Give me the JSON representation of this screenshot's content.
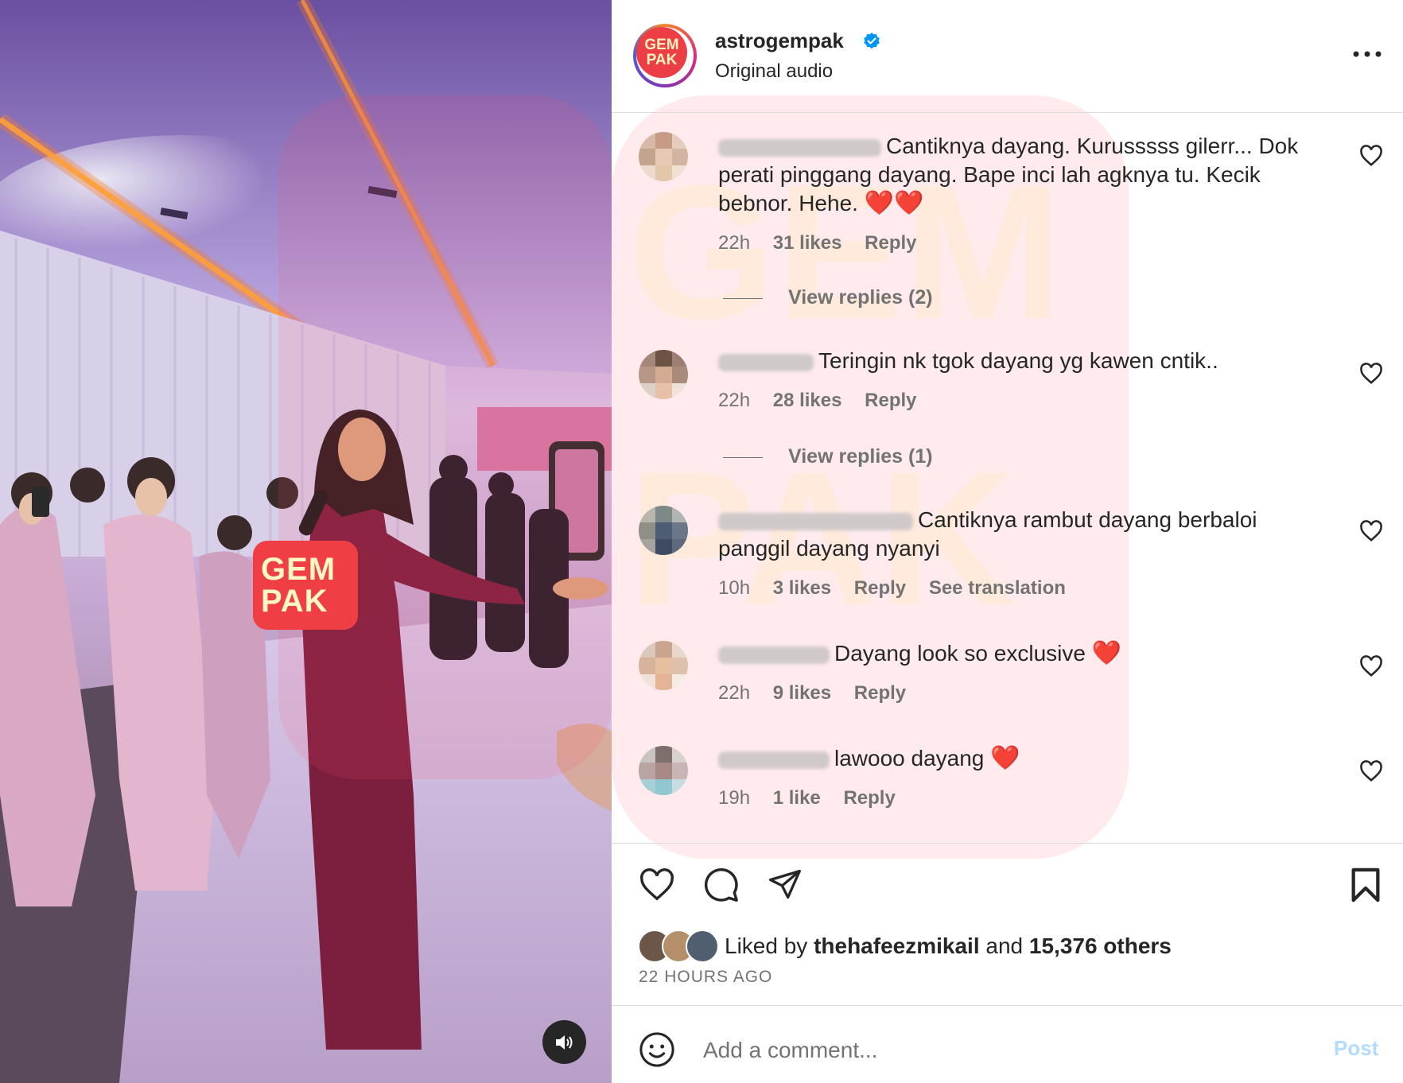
{
  "header": {
    "avatar_text_top": "GEM",
    "avatar_text_bottom": "PAK",
    "username": "astrogempak",
    "subtitle": "Original audio"
  },
  "video": {
    "watermark_top": "GEM",
    "watermark_bottom": "PAK"
  },
  "comments": [
    {
      "text": "Cantiknya dayang. Kurusssss gilerr... Dok perati pinggang dayang. Bape inci lah agknya tu. Kecik bebnor. Hehe.",
      "emoji": "❤️❤️",
      "time": "22h",
      "likes": "31 likes",
      "reply": "Reply",
      "view_replies": "View replies (2)"
    },
    {
      "text": "Teringin nk tgok dayang yg kawen cntik..",
      "emoji": "",
      "time": "22h",
      "likes": "28 likes",
      "reply": "Reply",
      "view_replies": "View replies (1)"
    },
    {
      "text": "Cantiknya rambut dayang berbaloi panggil dayang nyanyi",
      "emoji": "",
      "time": "10h",
      "likes": "3 likes",
      "reply": "Reply",
      "translation": "See translation"
    },
    {
      "text": "Dayang look so exclusive",
      "emoji": "❤️",
      "time": "22h",
      "likes": "9 likes",
      "reply": "Reply"
    },
    {
      "text": "lawooo dayang",
      "emoji": "❤️",
      "time": "19h",
      "likes": "1 like",
      "reply": "Reply"
    }
  ],
  "liked": {
    "prefix": "Liked by",
    "user": "thehafeezmikail",
    "and": "and",
    "others": "15,376 others"
  },
  "time_ago": "22 HOURS AGO",
  "comment_box": {
    "placeholder": "Add a comment...",
    "post_label": "Post"
  },
  "colors": {
    "verified": "#0095f6",
    "brand": "#ed3d45",
    "post_disabled": "#b3dbff",
    "meta": "#737373"
  }
}
